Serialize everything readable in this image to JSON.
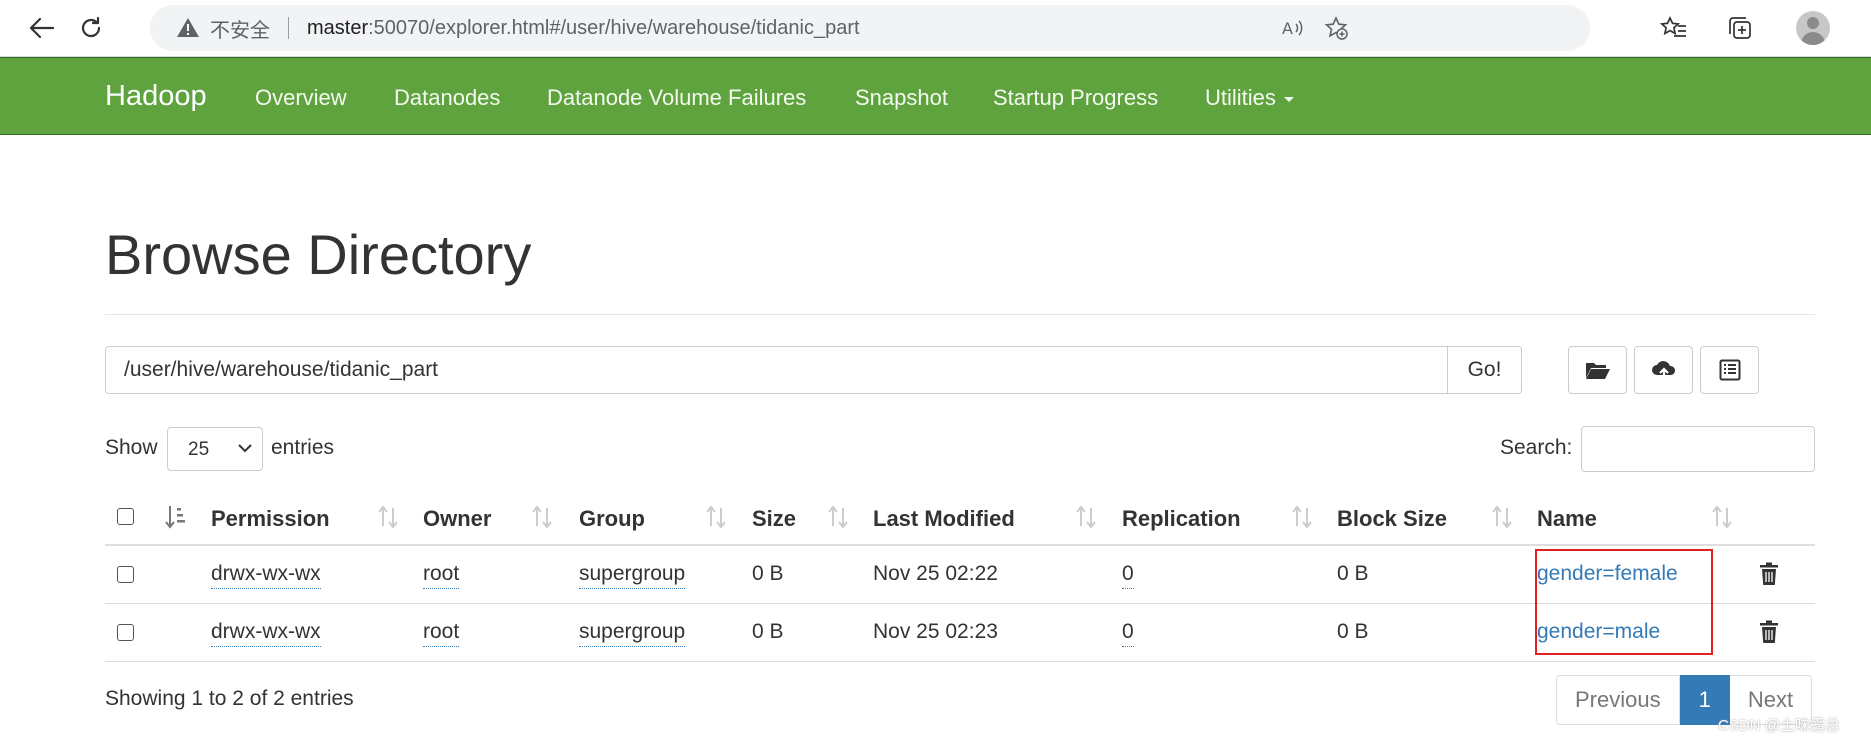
{
  "browser": {
    "insecure_label": "不安全",
    "url_host": "master",
    "url_rest": ":50070/explorer.html#/user/hive/warehouse/tidanic_part"
  },
  "navbar": {
    "brand": "Hadoop",
    "items": [
      {
        "label": "Overview"
      },
      {
        "label": "Datanodes"
      },
      {
        "label": "Datanode Volume Failures"
      },
      {
        "label": "Snapshot"
      },
      {
        "label": "Startup Progress"
      },
      {
        "label": "Utilities"
      }
    ]
  },
  "page": {
    "title": "Browse Directory",
    "path_value": "/user/hive/warehouse/tidanic_part",
    "go_label": "Go!"
  },
  "controls": {
    "show_label": "Show",
    "page_size": "25",
    "entries_label": "entries",
    "search_label": "Search:",
    "search_value": ""
  },
  "table": {
    "headers": {
      "permission": "Permission",
      "owner": "Owner",
      "group": "Group",
      "size": "Size",
      "last_modified": "Last Modified",
      "replication": "Replication",
      "block_size": "Block Size",
      "name": "Name"
    },
    "rows": [
      {
        "permission": "drwx-wx-wx",
        "owner": "root",
        "group": "supergroup",
        "size": "0 B",
        "last_modified": "Nov 25 02:22",
        "replication": "0",
        "block_size": "0 B",
        "name": "gender=female"
      },
      {
        "permission": "drwx-wx-wx",
        "owner": "root",
        "group": "supergroup",
        "size": "0 B",
        "last_modified": "Nov 25 02:23",
        "replication": "0",
        "block_size": "0 B",
        "name": "gender=male"
      }
    ]
  },
  "footer": {
    "info": "Showing 1 to 2 of 2 entries",
    "prev_label": "Previous",
    "current_page": "1",
    "next_label": "Next"
  },
  "watermark": "CSDN @土味霸总",
  "colors": {
    "navbar_green": "#5fa33e",
    "link_blue": "#337ab7",
    "highlight_red": "#e02020"
  }
}
